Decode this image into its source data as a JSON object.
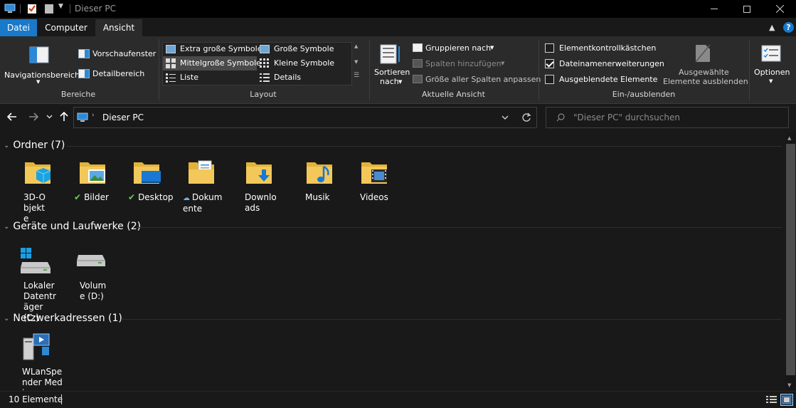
{
  "window": {
    "title": "Dieser PC"
  },
  "tabs": [
    {
      "label": "Datei"
    },
    {
      "label": "Computer"
    },
    {
      "label": "Ansicht"
    }
  ],
  "ribbon": {
    "panes": {
      "nav_pane": "Navigationsbereich",
      "preview_pane": "Vorschaufenster",
      "details_pane": "Detailbereich",
      "group_label": "Bereiche"
    },
    "layout": {
      "options": [
        "Extra große Symbole",
        "Große Symbole",
        "Mittelgroße Symbole",
        "Kleine Symbole",
        "Liste",
        "Details"
      ],
      "selected": "Mittelgroße Symbole",
      "group_label": "Layout"
    },
    "current_view": {
      "sort_by_line1": "Sortieren",
      "sort_by_line2": "nach",
      "group_by": "Gruppieren nach",
      "add_columns": "Spalten hinzufügen",
      "size_all_columns": "Größe aller Spalten anpassen",
      "group_label": "Aktuelle Ansicht"
    },
    "show_hide": {
      "item_checkboxes": "Elementkontrollkästchen",
      "file_extensions": "Dateinamenerweiterungen",
      "hidden_items": "Ausgeblendete Elemente",
      "hide_selected_line1": "Ausgewählte",
      "hide_selected_line2": "Elemente ausblenden",
      "item_checkboxes_checked": false,
      "file_extensions_checked": true,
      "hidden_items_checked": false,
      "group_label": "Ein-/ausblenden"
    },
    "options": {
      "label": "Optionen"
    }
  },
  "address": {
    "crumb": "Dieser PC"
  },
  "search": {
    "placeholder": "\"Dieser PC\" durchsuchen"
  },
  "sections": {
    "folders": {
      "title": "Ordner (7)",
      "items": [
        {
          "label": "3D-Objekte",
          "status": "",
          "icon": "3d-objects-folder-icon"
        },
        {
          "label": "Bilder",
          "status": "synced",
          "icon": "pictures-folder-icon"
        },
        {
          "label": "Desktop",
          "status": "synced",
          "icon": "desktop-folder-icon"
        },
        {
          "label": "Dokumente",
          "status": "cloud",
          "icon": "documents-folder-icon"
        },
        {
          "label": "Downloads",
          "status": "",
          "icon": "downloads-folder-icon"
        },
        {
          "label": "Musik",
          "status": "",
          "icon": "music-folder-icon"
        },
        {
          "label": "Videos",
          "status": "",
          "icon": "videos-folder-icon"
        }
      ]
    },
    "drives": {
      "title": "Geräte und Laufwerke (2)",
      "items": [
        {
          "label": "Lokaler Datenträger (C:)",
          "icon": "system-drive-icon"
        },
        {
          "label": "Volume (D:)",
          "icon": "drive-icon"
        }
      ]
    },
    "network": {
      "title": "Netzwerkadressen (1)",
      "items": [
        {
          "label": "WLanSpender Medi",
          "icon": "media-server-icon"
        }
      ]
    }
  },
  "status": {
    "count": "10 Elemente"
  },
  "colors": {
    "accent": "#1979ca",
    "folder": "#f3c85a",
    "background": "#191919",
    "ribbon": "#2b2b2b"
  }
}
